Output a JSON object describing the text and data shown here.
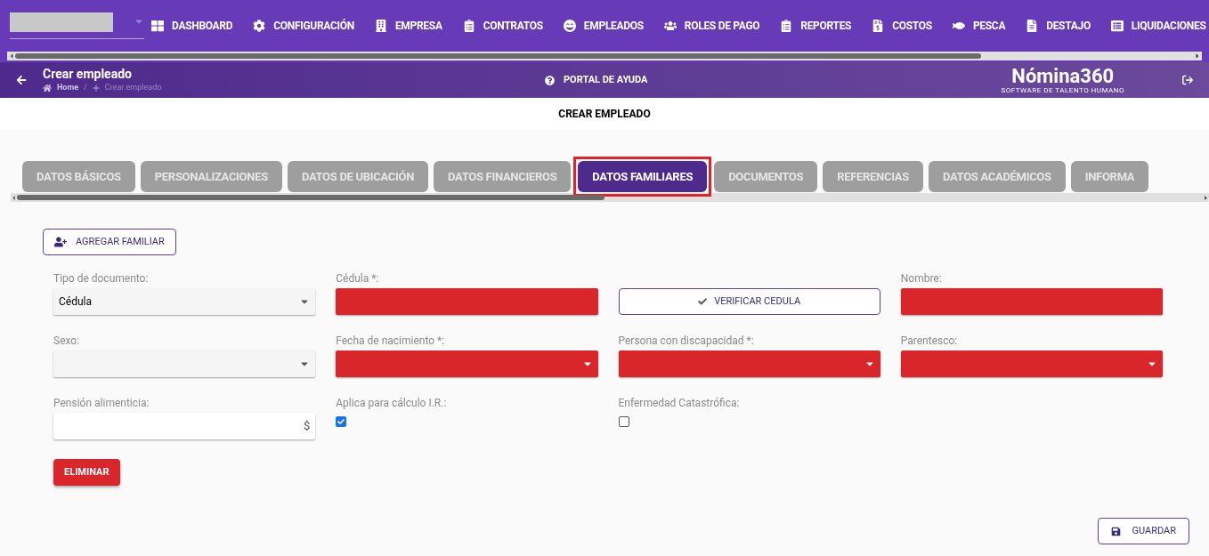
{
  "nav": [
    {
      "label": "DASHBOARD"
    },
    {
      "label": "CONFIGURACIÓN"
    },
    {
      "label": "EMPRESA"
    },
    {
      "label": "CONTRATOS"
    },
    {
      "label": "EMPLEADOS"
    },
    {
      "label": "ROLES DE PAGO"
    },
    {
      "label": "REPORTES"
    },
    {
      "label": "COSTOS"
    },
    {
      "label": "PESCA"
    },
    {
      "label": "DESTAJO"
    },
    {
      "label": "LIQUIDACIONES"
    }
  ],
  "header": {
    "title": "Crear empleado",
    "breadcrumb": [
      "Home",
      "Crear empleado"
    ],
    "breadcrumb_separator": "/",
    "help": "PORTAL DE AYUDA",
    "logo": "Nómina360",
    "logo_tagline": "SOFTWARE DE TALENTO HUMANO"
  },
  "page_title": "CREAR EMPLEADO",
  "tabs": [
    {
      "label": "DATOS BÁSICOS",
      "selected": false
    },
    {
      "label": "PERSONALIZACIONES",
      "selected": false
    },
    {
      "label": "DATOS DE UBICACIÓN",
      "selected": false
    },
    {
      "label": "DATOS FINANCIEROS",
      "selected": false
    },
    {
      "label": "DATOS FAMILIARES",
      "selected": true
    },
    {
      "label": "DOCUMENTOS",
      "selected": false
    },
    {
      "label": "REFERENCIAS",
      "selected": false
    },
    {
      "label": "DATOS ACADÉMICOS",
      "selected": false
    },
    {
      "label": "INFORMA",
      "selected": false
    }
  ],
  "add_button": "AGREGAR FAMILIAR",
  "fields": [
    {
      "kind": "select",
      "label": "Tipo de documento:",
      "value": "Cédula",
      "error": false
    },
    {
      "kind": "input",
      "label": "Cédula *:",
      "error": true
    },
    {
      "kind": "button",
      "label": "VERIFICAR CEDULA"
    },
    {
      "kind": "input",
      "label": "Nombre:",
      "error": true
    },
    {
      "kind": "select",
      "label": "Sexo:",
      "error": false
    },
    {
      "kind": "select",
      "label": "Fecha de nacimiento *:",
      "error": true
    },
    {
      "kind": "select",
      "label": "Persona con discapacidad *:",
      "error": true
    },
    {
      "kind": "select",
      "label": "Parentesco:",
      "error": true
    },
    {
      "kind": "input",
      "label": "Pensión alimenticia:",
      "suffix": "$",
      "error": false
    },
    {
      "kind": "checkbox",
      "label": "Aplica para cálculo I.R.:",
      "checked": true
    },
    {
      "kind": "checkbox",
      "label": "Enfermedad Catastrófica:",
      "checked": false
    }
  ],
  "delete_button": "ELIMINAR",
  "save_button": "GUARDAR"
}
